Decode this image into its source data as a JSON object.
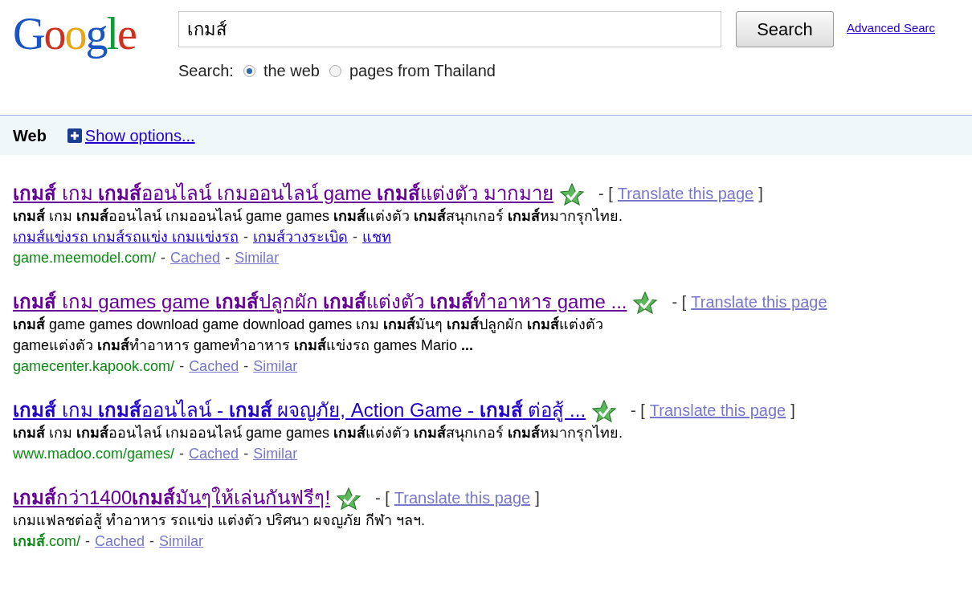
{
  "logo": "Google",
  "search": {
    "value": "เกมส์",
    "button": "Search",
    "advanced_link": "Advanced Searc"
  },
  "scope": {
    "label": "Search:",
    "options": [
      {
        "label": "the web",
        "selected": true
      },
      {
        "label": "pages from Thailand",
        "selected": false
      }
    ]
  },
  "bar": {
    "title": "Web",
    "options_link": "Show options..."
  },
  "results": [
    {
      "title": "**เกมส์** เกม **เกมส์**ออนไลน์ เกมออนไลน์ game **เกมส์**แต่งตัว มากมาย",
      "visited": true,
      "translate": [
        {
          "kind": "sep",
          "text": "- ["
        },
        {
          "kind": "link",
          "text": "Translate this page"
        },
        {
          "kind": "sep",
          "text": "]"
        }
      ],
      "snippet": [
        "**เกมส์** เกม **เกมส์**ออนไลน์ เกมออนไลน์ game games **เกมส์**แต่งตัว **เกมส์**สนุกเกอร์ **เกมส์**หมากรุกไทย."
      ],
      "sitelinks": [
        {
          "kind": "link",
          "text": "เกมส์แข่งรถ เกมส์รถแข่ง เกมแข่งรถ"
        },
        {
          "kind": "sep",
          "text": "-"
        },
        {
          "kind": "link",
          "text": "เกมส์วางระเบิด"
        },
        {
          "kind": "sep",
          "text": "-"
        },
        {
          "kind": "link",
          "text": "แชท"
        }
      ],
      "url_line": [
        {
          "kind": "url",
          "text": "game.meemodel.com/"
        },
        {
          "kind": "sep",
          "text": "-"
        },
        {
          "kind": "link",
          "text": "Cached"
        },
        {
          "kind": "sep",
          "text": "-"
        },
        {
          "kind": "link",
          "text": "Similar"
        }
      ]
    },
    {
      "title": "**เกมส์** เกม games game **เกมส์**ปลูกผัก **เกมส์**แต่งตัว **เกมส์**ทำอาหาร game ...",
      "visited": true,
      "translate": [
        {
          "kind": "sep",
          "text": "- ["
        },
        {
          "kind": "link",
          "text": "Translate this page"
        }
      ],
      "snippet": [
        "**เกมส์** game games download game download games เกม **เกมส์**มันๆ **เกมส์**ปลูกผัก **เกมส์**แต่งตัว",
        "gameแต่งตัว **เกมส์**ทำอาหาร gameทำอาหาร **เกมส์**แข่งรถ games Mario **...**"
      ],
      "url_line": [
        {
          "kind": "url",
          "text": "gamecenter.kapook.com/"
        },
        {
          "kind": "sep",
          "text": "-"
        },
        {
          "kind": "link",
          "text": "Cached"
        },
        {
          "kind": "sep",
          "text": "-"
        },
        {
          "kind": "link",
          "text": "Similar"
        }
      ]
    },
    {
      "title": "**เกมส์** เกม **เกมส์**ออนไลน์ - **เกมส์** ผจญภัย, Action Game - **เกมส์** ต่อสู้ ...",
      "visited": false,
      "translate": [
        {
          "kind": "sep",
          "text": "- ["
        },
        {
          "kind": "link",
          "text": "Translate this page"
        },
        {
          "kind": "sep",
          "text": "]"
        }
      ],
      "snippet": [
        "**เกมส์** เกม **เกมส์**ออนไลน์ เกมออนไลน์ game games **เกมส์**แต่งตัว **เกมส์**สนุกเกอร์ **เกมส์**หมากรุกไทย."
      ],
      "url_line": [
        {
          "kind": "url",
          "text": "www.madoo.com/games/"
        },
        {
          "kind": "sep",
          "text": "-"
        },
        {
          "kind": "link",
          "text": "Cached"
        },
        {
          "kind": "sep",
          "text": "-"
        },
        {
          "kind": "link",
          "text": "Similar"
        }
      ]
    },
    {
      "title": "**เกมส์**กว่า1400**เกมส์**มันๆให้เล่นกันฟรีๆ!",
      "visited": true,
      "translate": [
        {
          "kind": "sep",
          "text": "- ["
        },
        {
          "kind": "link",
          "text": "Translate this page"
        },
        {
          "kind": "sep",
          "text": "]"
        }
      ],
      "snippet": [
        "เกมแฟลชต่อสู้ ทำอาหาร รถแข่ง แต่งตัว ปริศนา ผจญภัย กีฬา ฯลฯ."
      ],
      "url_line": [
        {
          "kind": "url",
          "text": "**เกมส์**.com/"
        },
        {
          "kind": "sep",
          "text": "-"
        },
        {
          "kind": "link",
          "text": "Cached"
        },
        {
          "kind": "sep",
          "text": "-"
        },
        {
          "kind": "link",
          "text": "Similar"
        }
      ]
    }
  ]
}
